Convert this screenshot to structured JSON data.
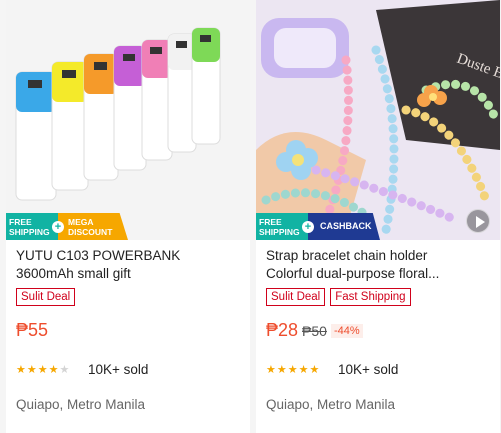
{
  "products": [
    {
      "title_line1": "YUTU C103 POWERBANK",
      "title_line2": "3600mAh small gift",
      "badge_free": "FREE SHIPPING",
      "badge_promo": "MEGA DISCOUNT",
      "tags": [
        "Sulit Deal"
      ],
      "price": "₱55",
      "original_price": "",
      "discount": "",
      "rating": 4,
      "sold": "10K+ sold",
      "location": "Quiapo, Metro Manila"
    },
    {
      "title_line1": "Strap bracelet chain holder",
      "title_line2": "Colorful dual-purpose floral...",
      "badge_free": "FREE SHIPPING",
      "badge_promo": "CASHBACK",
      "tags": [
        "Sulit Deal",
        "Fast Shipping"
      ],
      "price": "₱28",
      "original_price": "₱50",
      "discount": "-44%",
      "rating": 5,
      "sold": "10K+ sold",
      "location": "Quiapo, Metro Manila",
      "image_text": "Duste Blackish"
    }
  ],
  "colors": {
    "price": "#ee4d2d",
    "tag": "#d0011b",
    "free_badge": "#11b3a3",
    "mega_badge": "#f6a700",
    "cashback_badge": "#1f3a93",
    "star": "#f6a700"
  },
  "icons": {
    "play": "play-icon",
    "plus": "plus-icon",
    "star": "star-icon"
  }
}
